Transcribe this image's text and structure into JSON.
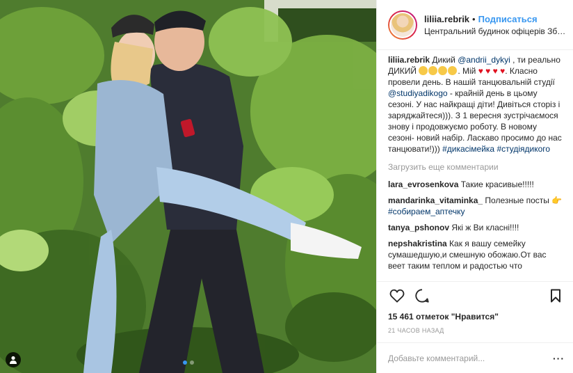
{
  "header": {
    "username": "liliia.rebrik",
    "separator": "•",
    "follow_label": "Подписаться",
    "location": "Центральний будинок офіцерів Збройних Сил України"
  },
  "caption": {
    "username": "liliia.rebrik",
    "text_1": "Дикий ",
    "mention_1": "@andrii_dykyi",
    "text_2": " , ти реально ДИКИЙ ",
    "text_3": ". Мій ",
    "text_4": ". Класно провели день. В нашій танцювальній студії ",
    "mention_2": "@studiyadikogo",
    "text_5": " - крайній день в цьому сезоні. У нас найкращі діти! Дивіться сторіз і заряджайтеся))). З 1 вересня зустрічаємося знову і продовжуємо роботу. В новому сезоні- новий набір. Ласкаво просимо до нас танцювати!)))",
    "hashtag_1": "#дикасімейка",
    "hashtag_2": "#студіядикого",
    "heart": "♥"
  },
  "load_more": "Загрузить еще комментарии",
  "comments": [
    {
      "user": "lara_evrosenkova",
      "text": "Такие красивые!!!!!"
    },
    {
      "user": "mandarinka_vitaminka_",
      "text": "Полезные посты",
      "pointer": "👉",
      "tag": "#собираем_аптечку"
    },
    {
      "user": "tanya_pshonov",
      "text": "Які ж Ви класні!!!!"
    },
    {
      "user": "nepshakristina",
      "text": "Как я вашу семейку сумашедшую,и смешную обожаю.От вас веет таким теплом и радостью что"
    }
  ],
  "icons": {
    "like": "heart-icon",
    "comment": "comment-icon",
    "save": "bookmark-icon",
    "user_tag": "person-icon"
  },
  "likes_text": "15 461 отметок \"Нравится\"",
  "time_text": "21 ЧАСОВ НАЗАД",
  "add_comment": {
    "placeholder": "Добавьте комментарий..."
  },
  "carousel": {
    "count": 2,
    "active_index": 0
  },
  "colors": {
    "accent": "#3897f0",
    "text": "#262626",
    "muted": "#999999",
    "heart": "#e0101f"
  }
}
